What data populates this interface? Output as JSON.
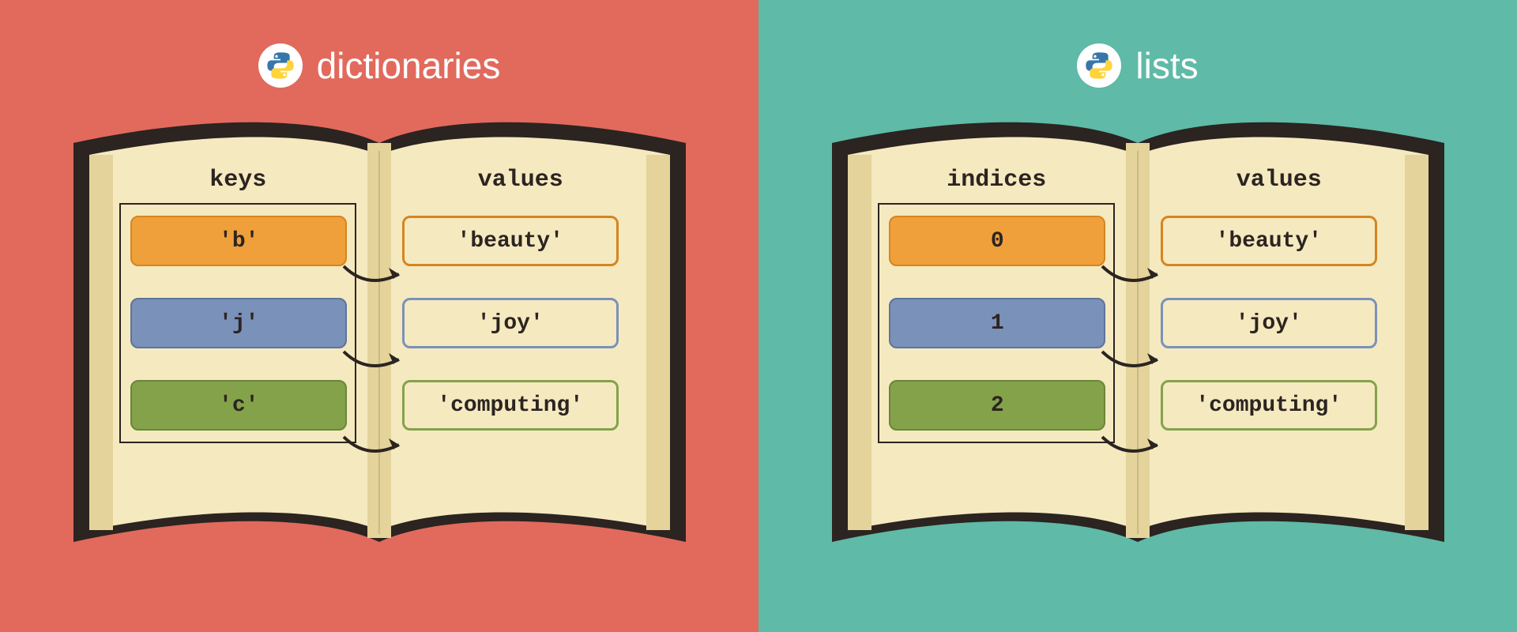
{
  "left": {
    "title": "dictionaries",
    "leftHeader": "keys",
    "rightHeader": "values",
    "rows": [
      {
        "key": "'b'",
        "value": "'beauty'"
      },
      {
        "key": "'j'",
        "value": "'joy'"
      },
      {
        "key": "'c'",
        "value": "'computing'"
      }
    ]
  },
  "right": {
    "title": "lists",
    "leftHeader": "indices",
    "rightHeader": "values",
    "rows": [
      {
        "key": "0",
        "value": "'beauty'"
      },
      {
        "key": "1",
        "value": "'joy'"
      },
      {
        "key": "2",
        "value": "'computing'"
      }
    ]
  },
  "colors": [
    "orange",
    "blue",
    "green"
  ]
}
